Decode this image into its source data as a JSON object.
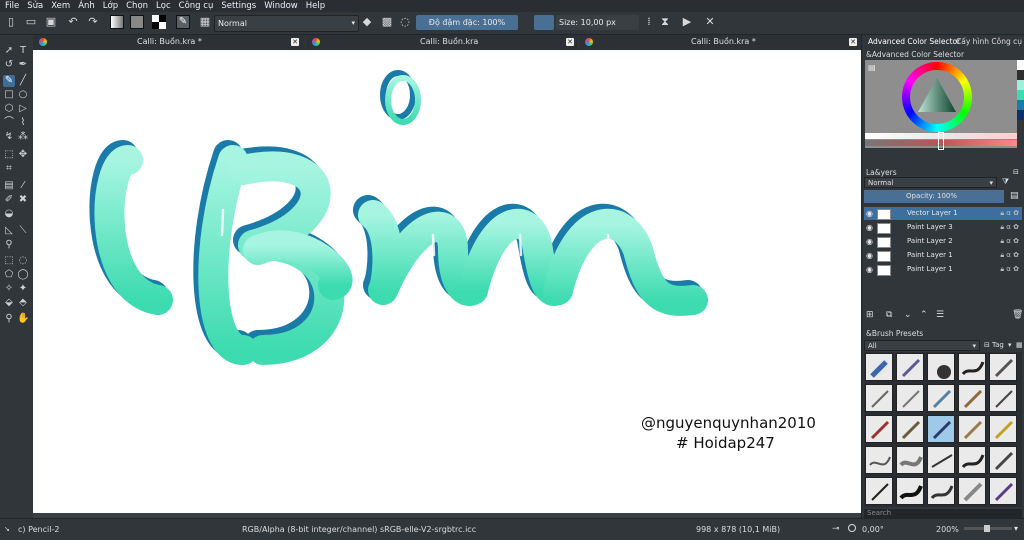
{
  "menu": [
    "File",
    "Sửa",
    "Xem",
    "Ảnh",
    "Lớp",
    "Chọn",
    "Lọc",
    "Công cụ",
    "Settings",
    "Window",
    "Help"
  ],
  "toolbar": {
    "blend_mode": "Normal",
    "opacity": "Độ đậm đặc: 100%",
    "size": "Size: 10,00 px"
  },
  "tabs": [
    {
      "title": "Calli: Buồn.kra *"
    },
    {
      "title": "Calli: Buồn.kra"
    },
    {
      "title": "Calli: Buồn.kra *"
    }
  ],
  "canvas": {
    "lettering_colors": {
      "fill_top": "#a7f5e1",
      "fill_bottom": "#3ddbb0",
      "shadow": "#1a7aa8"
    },
    "credit_line1": "@nguyenquynhan2010",
    "credit_line2": "# Hoidap247"
  },
  "dock": {
    "tabs": [
      "Advanced Color Selector",
      "Cấy hình Công cụ"
    ],
    "color_selector_title": "&Advanced Color Selector",
    "layers_title": "La&yers",
    "layers_blend": "Normal",
    "layers_opacity": "Opacity: 100%",
    "layers": [
      {
        "name": "Vector Layer 1",
        "selected": true
      },
      {
        "name": "Paint Layer 3",
        "selected": false
      },
      {
        "name": "Paint Layer 2",
        "selected": false
      },
      {
        "name": "Paint Layer 1",
        "selected": false
      },
      {
        "name": "Paint Layer 1",
        "selected": false
      }
    ],
    "brush_presets_title": "&Brush Presets",
    "brush_filter": "All",
    "brush_tag": "Tag",
    "search_placeholder": "Search"
  },
  "status": {
    "tool": "c) Pencil-2",
    "color_info": "RGB/Alpha (8-bit integer/channel)  sRGB-elle-V2-srgbtrc.icc",
    "dimensions": "998 x 878 (10,1 MiB)",
    "angle": "0,00°",
    "zoom": "200%"
  },
  "colors": {
    "accent": "#3d6f9e",
    "panel": "#31363b",
    "menubar": "#2a2e32"
  }
}
